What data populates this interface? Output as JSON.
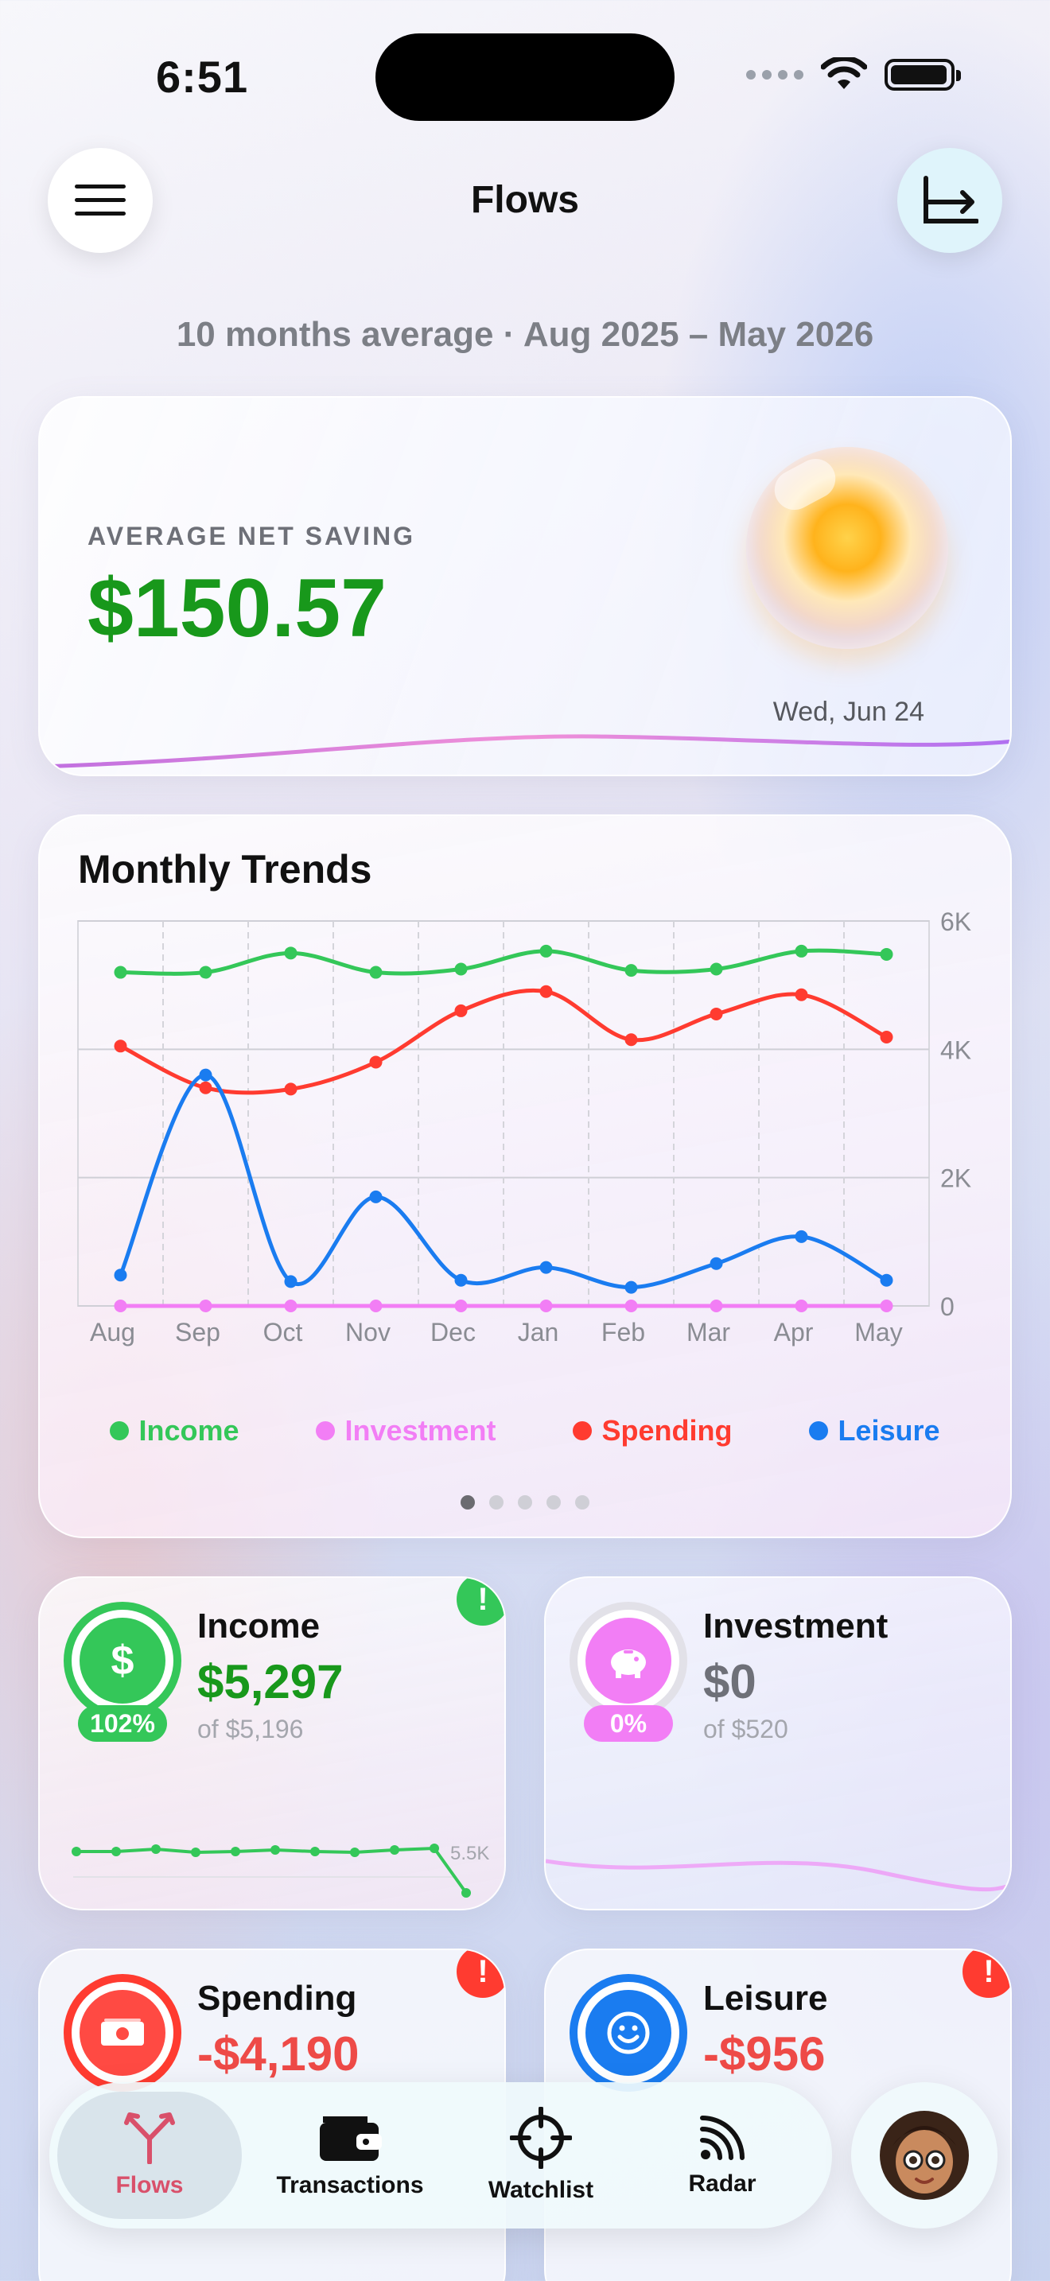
{
  "status_bar": {
    "time": "6:51"
  },
  "header": {
    "title": "Flows",
    "menu_icon": "hamburger-menu-icon",
    "chart_icon": "chart-axis-arrow-icon"
  },
  "subtitle": "10 months average · Aug 2025 – May 2026",
  "net_saving": {
    "label": "AVERAGE NET SAVING",
    "value": "$150.57",
    "date": "Wed, Jun 24",
    "value_color": "#18981b"
  },
  "trends": {
    "title": "Monthly Trends",
    "pager": {
      "pages": 5,
      "active": 0
    }
  },
  "chart_data": {
    "type": "line",
    "x": [
      "Aug",
      "Sep",
      "Oct",
      "Nov",
      "Dec",
      "Jan",
      "Feb",
      "Mar",
      "Apr",
      "May"
    ],
    "y_ticks": [
      "6K",
      "4K",
      "2K",
      "0"
    ],
    "ylim": [
      0,
      6000
    ],
    "grid": true,
    "legend_position": "bottom",
    "series": [
      {
        "name": "Income",
        "color": "#34c759",
        "values": [
          5200,
          5200,
          5500,
          5200,
          5250,
          5530,
          5230,
          5250,
          5530,
          5480
        ]
      },
      {
        "name": "Investment",
        "color": "#f27ef5",
        "values": [
          0,
          0,
          0,
          0,
          0,
          0,
          0,
          0,
          0,
          0
        ]
      },
      {
        "name": "Spending",
        "color": "#ff3b30",
        "values": [
          4050,
          3400,
          3380,
          3800,
          4600,
          4900,
          4150,
          4550,
          4850,
          4190
        ]
      },
      {
        "name": "Leisure",
        "color": "#1a7cf0",
        "values": [
          480,
          3600,
          380,
          1700,
          400,
          600,
          290,
          660,
          1080,
          400
        ]
      }
    ]
  },
  "cards": {
    "income": {
      "title": "Income",
      "value": "$5,297",
      "of": "of $5,196",
      "pct": "102%",
      "spark_label": "5.5K",
      "icon": "dollar-icon",
      "color": "#34c759",
      "value_color": "#18981b",
      "alert": "!"
    },
    "investment": {
      "title": "Investment",
      "value": "$0",
      "of": "of $520",
      "pct": "0%",
      "icon": "piggy-bank-icon",
      "color": "#f27ef5",
      "value_color": "#6e7078"
    },
    "spending": {
      "title": "Spending",
      "value": "-$4,190",
      "icon": "banknote-icon",
      "color": "#ff3b30",
      "value_color": "#ee4a47",
      "alert": "!"
    },
    "leisure": {
      "title": "Leisure",
      "value": "-$956",
      "icon": "smiley-icon",
      "color": "#1a7cf0",
      "value_color": "#ee4a47",
      "alert": "!"
    }
  },
  "tabbar": {
    "tabs": [
      {
        "label": "Flows",
        "icon": "fork-arrows-icon",
        "active": true
      },
      {
        "label": "Transactions",
        "icon": "wallet-icon",
        "active": false
      },
      {
        "label": "Watchlist",
        "icon": "crosshair-icon",
        "active": false
      },
      {
        "label": "Radar",
        "icon": "signal-waves-icon",
        "active": false
      }
    ],
    "avatar_icon": "user-avatar-icon"
  }
}
